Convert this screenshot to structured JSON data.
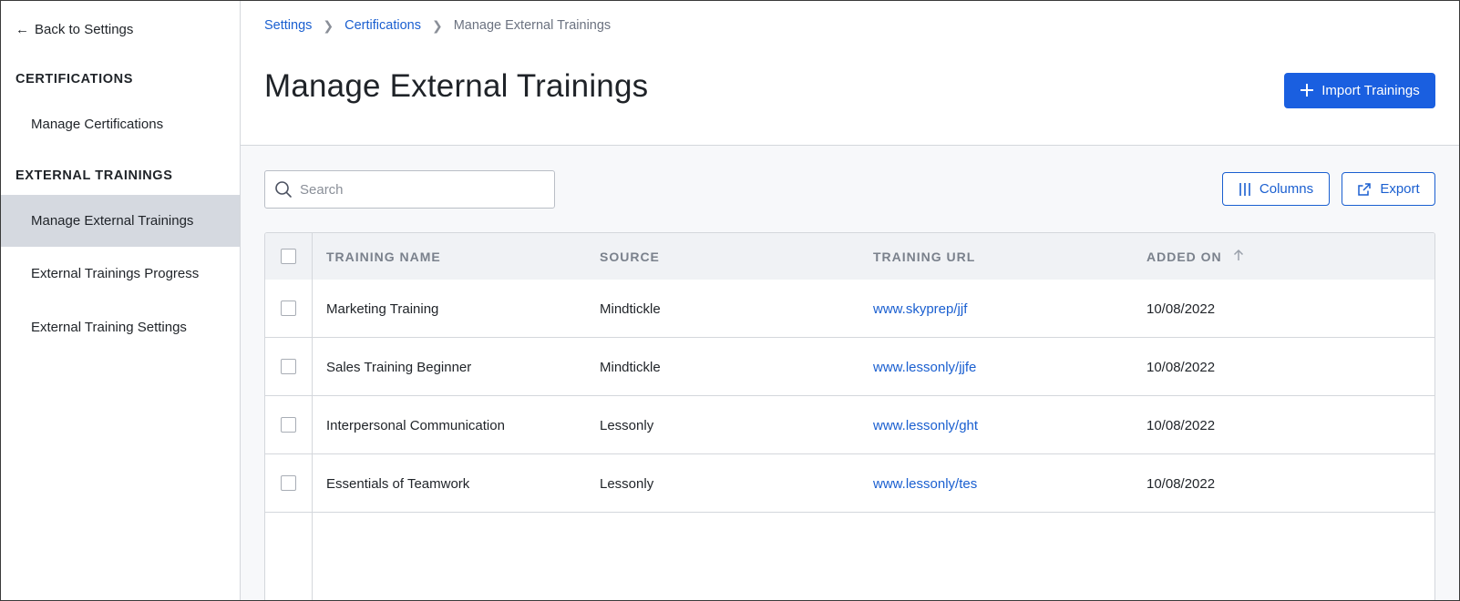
{
  "sidebar": {
    "back_label": "Back to Settings",
    "sections": [
      {
        "title": "CERTIFICATIONS",
        "items": [
          {
            "label": "Manage Certifications",
            "active": false
          }
        ]
      },
      {
        "title": "EXTERNAL TRAININGS",
        "items": [
          {
            "label": "Manage External Trainings",
            "active": true
          },
          {
            "label": "External Trainings Progress",
            "active": false
          },
          {
            "label": "External Training Settings",
            "active": false
          }
        ]
      }
    ]
  },
  "breadcrumb": {
    "items": [
      {
        "label": "Settings",
        "link": true
      },
      {
        "label": "Certifications",
        "link": true
      },
      {
        "label": "Manage External Trainings",
        "link": false
      }
    ]
  },
  "header": {
    "title": "Manage External Trainings",
    "import_label": "Import Trainings"
  },
  "toolbar": {
    "search_placeholder": "Search",
    "search_value": "",
    "columns_label": "Columns",
    "export_label": "Export"
  },
  "table": {
    "columns": [
      "TRAINING NAME",
      "SOURCE",
      "TRAINING URL",
      "ADDED ON"
    ],
    "sorted_column": "ADDED ON",
    "sort_direction": "asc",
    "rows": [
      {
        "name": "Marketing Training",
        "source": "Mindtickle",
        "url": "www.skyprep/jjf",
        "added_on": "10/08/2022"
      },
      {
        "name": "Sales Training Beginner",
        "source": "Mindtickle",
        "url": "www.lessonly/jjfe",
        "added_on": "10/08/2022"
      },
      {
        "name": "Interpersonal Communication",
        "source": "Lessonly",
        "url": "www.lessonly/ght",
        "added_on": "10/08/2022"
      },
      {
        "name": "Essentials of Teamwork",
        "source": "Lessonly",
        "url": "www.lessonly/tes",
        "added_on": "10/08/2022"
      }
    ]
  },
  "colors": {
    "primary": "#1a5fe0",
    "link": "#1a5fd0",
    "active_nav_bg": "#d5d9e0",
    "header_bg": "#f0f2f5"
  }
}
